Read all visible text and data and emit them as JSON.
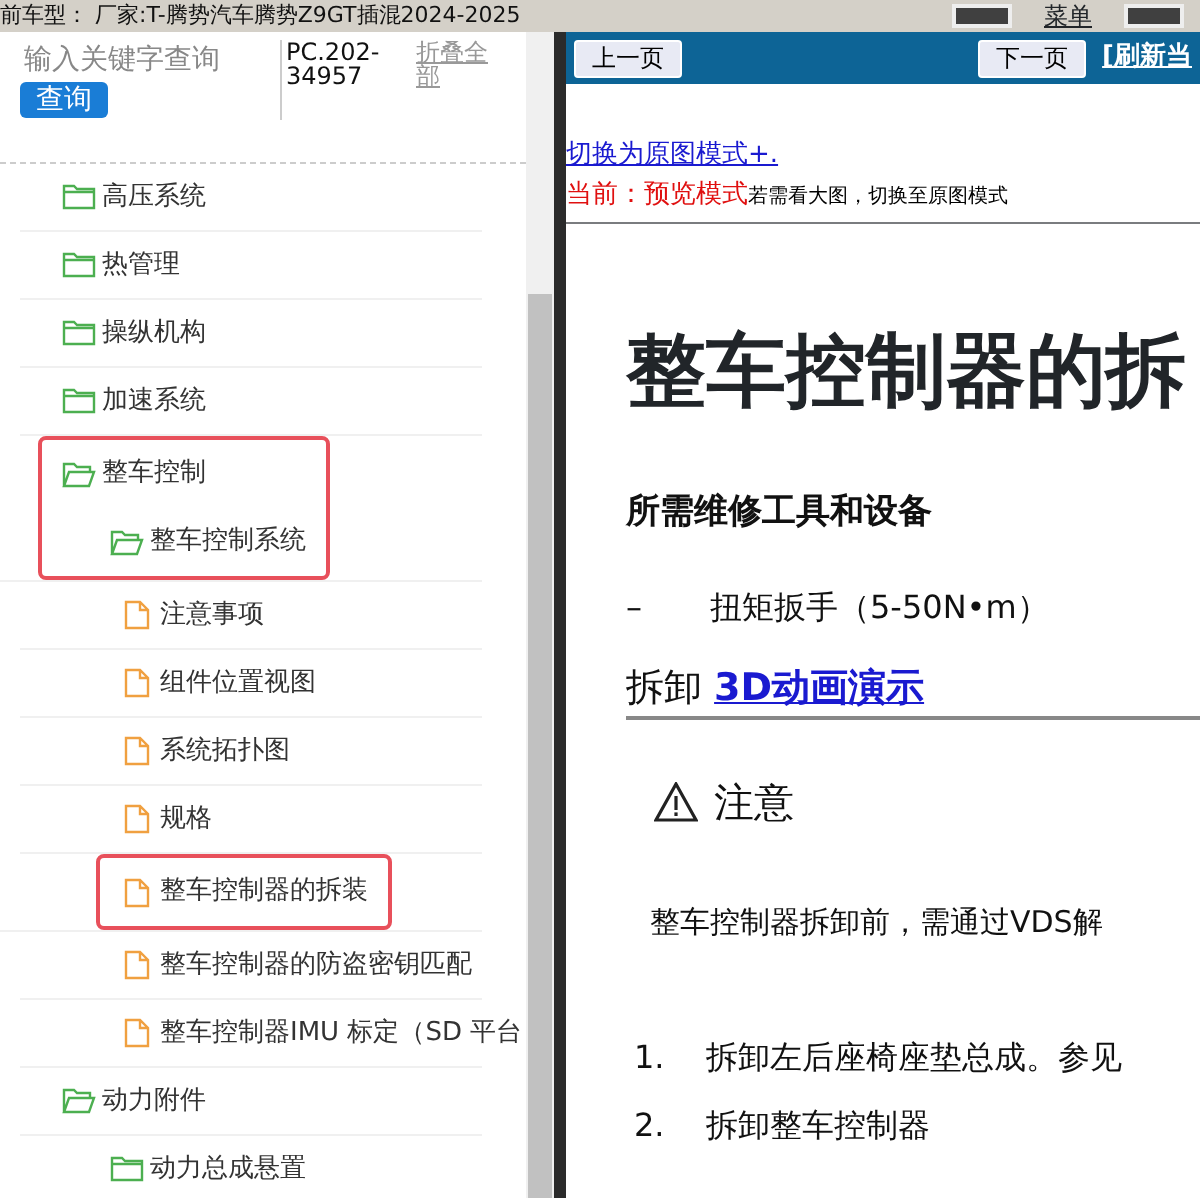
{
  "top_bar": {
    "title": "前车型： 厂家:T-腾势汽车腾势Z9GT插混2024-2025",
    "menu_label": "菜单"
  },
  "search": {
    "placeholder": "输入关键字查询",
    "button": "查询",
    "code": "PC.202-34957",
    "collapse_all": "折叠全部"
  },
  "tree": [
    {
      "label": "高压系统",
      "kind": "folder",
      "expanded": false,
      "highlighted": false
    },
    {
      "label": "热管理",
      "kind": "folder",
      "expanded": false,
      "highlighted": false
    },
    {
      "label": "操纵机构",
      "kind": "folder",
      "expanded": false,
      "highlighted": false
    },
    {
      "label": "加速系统",
      "kind": "folder",
      "expanded": false,
      "highlighted": false
    },
    {
      "label": "整车控制",
      "kind": "folder",
      "expanded": true,
      "highlighted": true,
      "children": [
        {
          "label": "整车控制系统",
          "kind": "folder",
          "expanded": true,
          "highlighted": true,
          "children": [
            {
              "label": "注意事项",
              "kind": "document",
              "highlighted": false
            },
            {
              "label": "组件位置视图",
              "kind": "document",
              "highlighted": false
            },
            {
              "label": "系统拓扑图",
              "kind": "document",
              "highlighted": false
            },
            {
              "label": "规格",
              "kind": "document",
              "highlighted": false
            },
            {
              "label": "整车控制器的拆装",
              "kind": "document",
              "highlighted": true
            },
            {
              "label": "整车控制器的防盗密钥匹配",
              "kind": "document",
              "highlighted": false
            },
            {
              "label": "整车控制器IMU 标定（SD 平台",
              "kind": "document",
              "highlighted": false
            }
          ]
        }
      ]
    },
    {
      "label": "动力附件",
      "kind": "folder",
      "expanded": true,
      "highlighted": false,
      "children": [
        {
          "label": "动力总成悬置",
          "kind": "folder",
          "expanded": false,
          "highlighted": false
        }
      ]
    }
  ],
  "nav": {
    "prev": "上一页",
    "next": "下一页",
    "refresh": "[刷新当"
  },
  "mode": {
    "switch_link": "切换为原图模式+.",
    "current": "当前：预览模式",
    "hint": "若需看大图，切换至原图模式"
  },
  "document": {
    "title": "整车控制器的拆",
    "tools_heading": "所需维修工具和设备",
    "tools": [
      {
        "dash": "–",
        "text": "扭矩扳手（5-50N•m）"
      }
    ],
    "removal_label": "拆卸",
    "animation_link": "3D动画演示",
    "caution_heading": "注意",
    "caution_text": "整车控制器拆卸前，需通过VDS解",
    "steps": [
      {
        "number": "1.",
        "text": "拆卸左后座椅座垫总成。参见"
      },
      {
        "number": "2.",
        "text": "拆卸整车控制器"
      }
    ]
  }
}
